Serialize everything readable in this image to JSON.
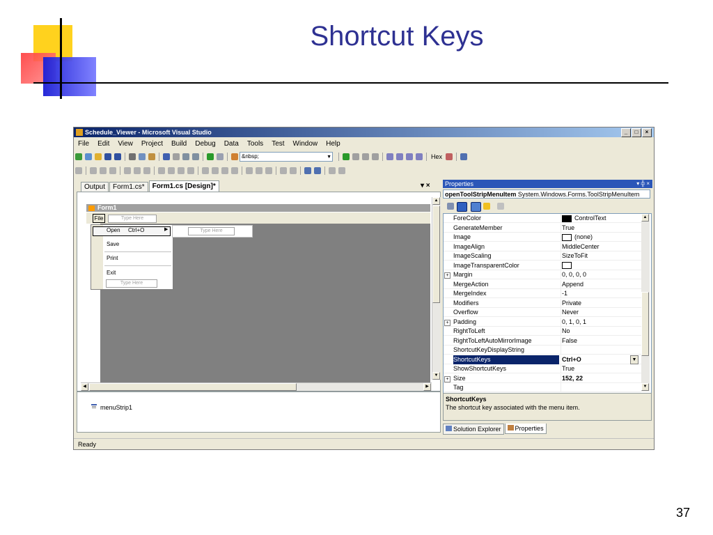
{
  "slide": {
    "title": "Shortcut Keys",
    "page_number": "37"
  },
  "window": {
    "title": "Schedule_Viewer - Microsoft Visual Studio",
    "min": "_",
    "max": "□",
    "close": "×"
  },
  "menubar": [
    "File",
    "Edit",
    "View",
    "Project",
    "Build",
    "Debug",
    "Data",
    "Tools",
    "Test",
    "Window",
    "Help"
  ],
  "toolbar": {
    "combo_value": "&nbsp;",
    "hex_label": "Hex"
  },
  "doc_tabs": [
    "Output",
    "Form1.cs*",
    "Form1.cs [Design]*"
  ],
  "designer": {
    "form_title": "Form1",
    "file_menu": "File",
    "menubar_type_here": "Type Here",
    "dropdown": {
      "items": [
        "Open",
        "Save",
        "Print",
        "Exit"
      ],
      "open_shortcut": "Ctrl+O",
      "submenu_arrow": "▶",
      "type_here": "Type Here",
      "submenu_type_here": "Type Here"
    },
    "tray_item": "menuStrip1"
  },
  "properties": {
    "title": "Properties",
    "title_controls": "▾ ╬ ×",
    "object_name": "openToolStripMenuItem",
    "object_type": "System.Windows.Forms.ToolStripMenuItem",
    "rows": [
      {
        "name": "ForeColor",
        "value": "ControlText"
      },
      {
        "name": "GenerateMember",
        "value": "True"
      },
      {
        "name": "Image",
        "value": "(none)"
      },
      {
        "name": "ImageAlign",
        "value": "MiddleCenter"
      },
      {
        "name": "ImageScaling",
        "value": "SizeToFit"
      },
      {
        "name": "ImageTransparentColor",
        "value": ""
      },
      {
        "name": "Margin",
        "value": "0, 0, 0, 0"
      },
      {
        "name": "MergeAction",
        "value": "Append"
      },
      {
        "name": "MergeIndex",
        "value": "-1"
      },
      {
        "name": "Modifiers",
        "value": "Private"
      },
      {
        "name": "Overflow",
        "value": "Never"
      },
      {
        "name": "Padding",
        "value": "0, 1, 0, 1"
      },
      {
        "name": "RightToLeft",
        "value": "No"
      },
      {
        "name": "RightToLeftAutoMirrorImage",
        "value": "False"
      },
      {
        "name": "ShortcutKeyDisplayString",
        "value": ""
      },
      {
        "name": "ShortcutKeys",
        "value": "Ctrl+O"
      },
      {
        "name": "ShowShortcutKeys",
        "value": "True"
      },
      {
        "name": "Size",
        "value": "152, 22"
      },
      {
        "name": "Tag",
        "value": ""
      }
    ],
    "description_title": "ShortcutKeys",
    "description_text": "The shortcut key associated with the menu item.",
    "bottom_tabs": [
      "Solution Explorer",
      "Properties"
    ]
  },
  "status": "Ready",
  "colors": {
    "slide_title": "#2e3192",
    "title_bar": "#0a246a",
    "selection": "#0a246a",
    "designer_bg": "#808080"
  }
}
